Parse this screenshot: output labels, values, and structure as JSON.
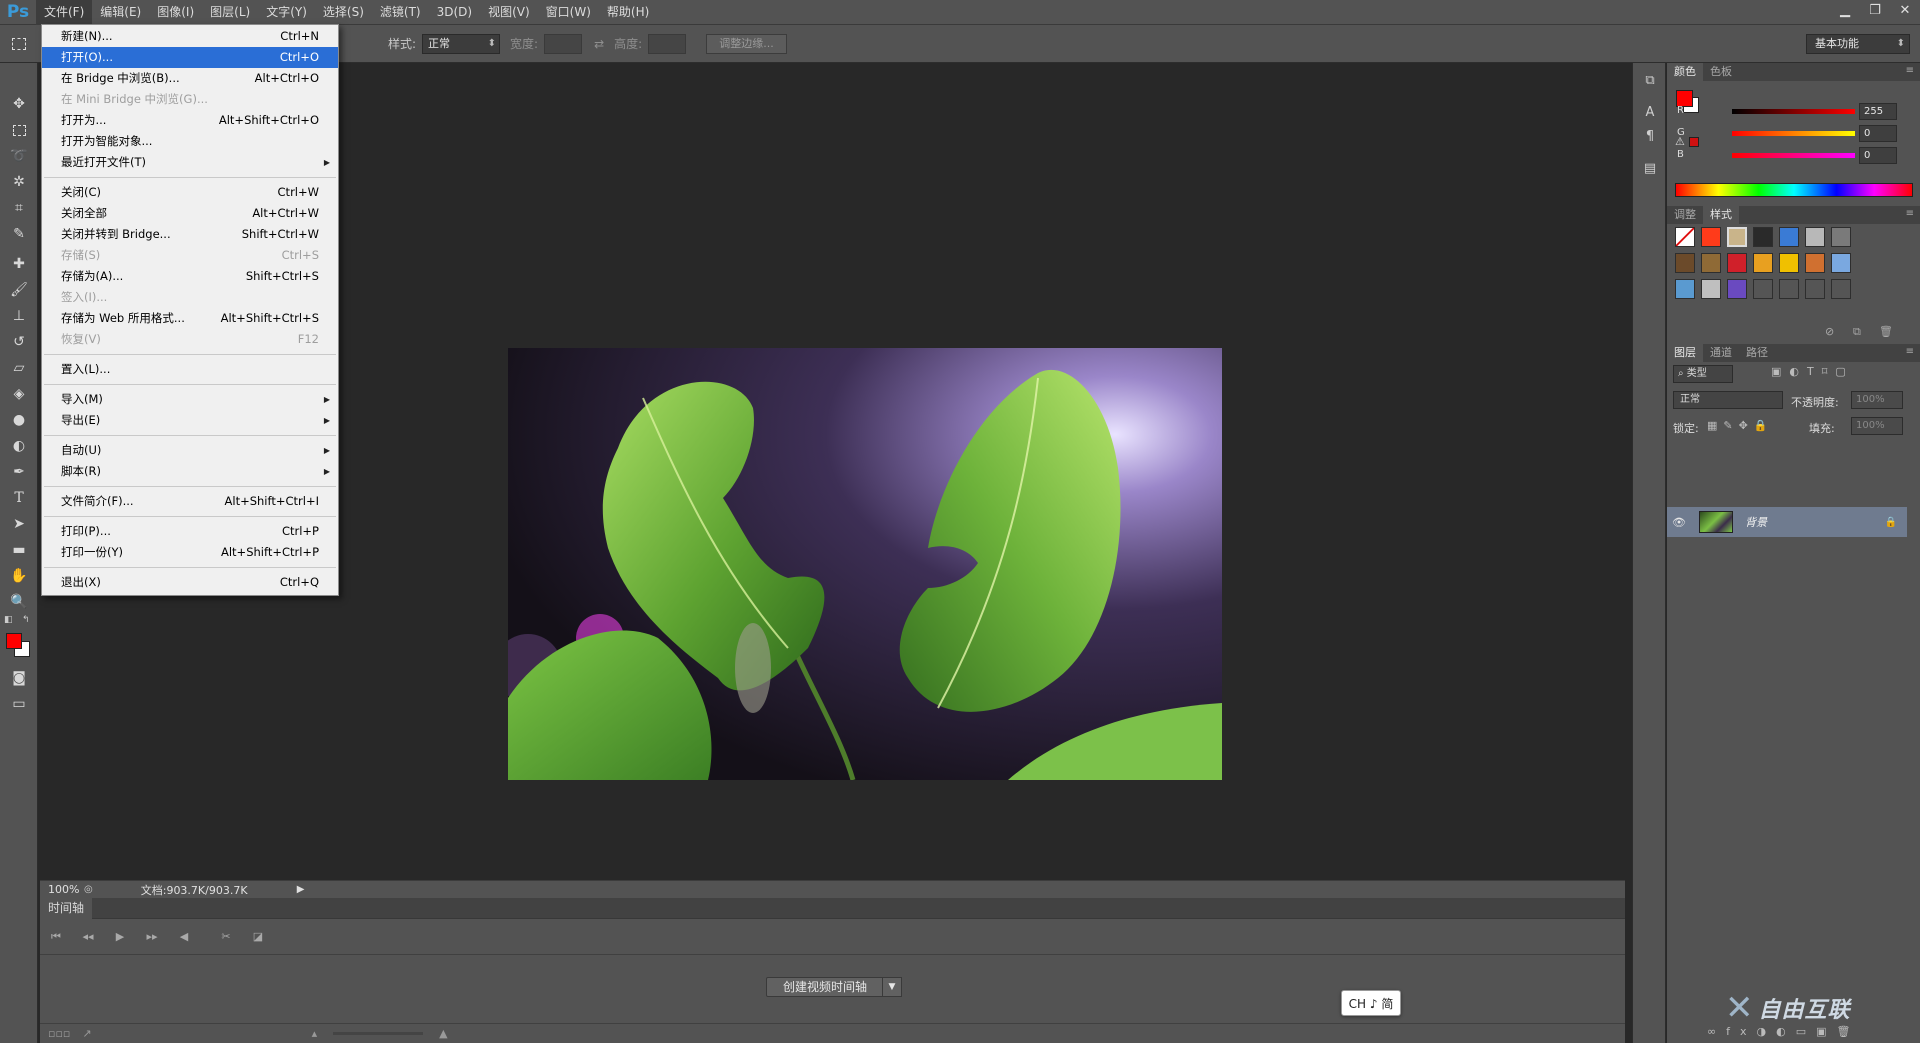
{
  "app": {
    "logo": "Ps",
    "menu": [
      "文件(F)",
      "编辑(E)",
      "图像(I)",
      "图层(L)",
      "文字(Y)",
      "选择(S)",
      "滤镜(T)",
      "3D(D)",
      "视图(V)",
      "窗口(W)",
      "帮助(H)"
    ],
    "active_menu_index": 0
  },
  "options_bar": {
    "style_label": "样式:",
    "style_value": "正常",
    "width_label": "宽度:",
    "height_label": "高度:",
    "refine_edge": "调整边缘...",
    "workspace": "基本功能"
  },
  "file_menu": {
    "items": [
      {
        "label": "新建(N)...",
        "shortcut": "Ctrl+N",
        "state": "normal"
      },
      {
        "label": "打开(O)...",
        "shortcut": "Ctrl+O",
        "state": "highlight"
      },
      {
        "label": "在 Bridge 中浏览(B)...",
        "shortcut": "Alt+Ctrl+O",
        "state": "normal"
      },
      {
        "label": "在 Mini Bridge 中浏览(G)...",
        "shortcut": "",
        "state": "disabled"
      },
      {
        "label": "打开为...",
        "shortcut": "Alt+Shift+Ctrl+O",
        "state": "normal"
      },
      {
        "label": "打开为智能对象...",
        "shortcut": "",
        "state": "normal"
      },
      {
        "label": "最近打开文件(T)",
        "shortcut": "",
        "state": "normal",
        "submenu": true
      },
      {
        "separator": true
      },
      {
        "label": "关闭(C)",
        "shortcut": "Ctrl+W",
        "state": "normal"
      },
      {
        "label": "关闭全部",
        "shortcut": "Alt+Ctrl+W",
        "state": "normal"
      },
      {
        "label": "关闭并转到 Bridge...",
        "shortcut": "Shift+Ctrl+W",
        "state": "normal"
      },
      {
        "label": "存储(S)",
        "shortcut": "Ctrl+S",
        "state": "disabled"
      },
      {
        "label": "存储为(A)...",
        "shortcut": "Shift+Ctrl+S",
        "state": "normal"
      },
      {
        "label": "签入(I)...",
        "shortcut": "",
        "state": "disabled"
      },
      {
        "label": "存储为 Web 所用格式...",
        "shortcut": "Alt+Shift+Ctrl+S",
        "state": "normal"
      },
      {
        "label": "恢复(V)",
        "shortcut": "F12",
        "state": "disabled"
      },
      {
        "separator": true
      },
      {
        "label": "置入(L)...",
        "shortcut": "",
        "state": "normal"
      },
      {
        "separator": true
      },
      {
        "label": "导入(M)",
        "shortcut": "",
        "state": "normal",
        "submenu": true
      },
      {
        "label": "导出(E)",
        "shortcut": "",
        "state": "normal",
        "submenu": true
      },
      {
        "separator": true
      },
      {
        "label": "自动(U)",
        "shortcut": "",
        "state": "normal",
        "submenu": true
      },
      {
        "label": "脚本(R)",
        "shortcut": "",
        "state": "normal",
        "submenu": true
      },
      {
        "separator": true
      },
      {
        "label": "文件简介(F)...",
        "shortcut": "Alt+Shift+Ctrl+I",
        "state": "normal"
      },
      {
        "separator": true
      },
      {
        "label": "打印(P)...",
        "shortcut": "Ctrl+P",
        "state": "normal"
      },
      {
        "label": "打印一份(Y)",
        "shortcut": "Alt+Shift+Ctrl+P",
        "state": "normal"
      },
      {
        "separator": true
      },
      {
        "label": "退出(X)",
        "shortcut": "Ctrl+Q",
        "state": "normal"
      }
    ]
  },
  "status_bar": {
    "zoom": "100%",
    "doc_info": "文档:903.7K/903.7K"
  },
  "timeline": {
    "tab": "时间轴",
    "create_button": "创建视频时间轴"
  },
  "color_panel": {
    "tabs": [
      "颜色",
      "色板"
    ],
    "r_label": "R",
    "r_value": "255",
    "g_label": "G",
    "g_value": "0",
    "b_label": "B",
    "b_value": "0",
    "foreground": "#ff0000",
    "background": "#ffffff"
  },
  "styles_panel": {
    "tabs": [
      "调整",
      "样式"
    ]
  },
  "layers_panel": {
    "tabs": [
      "图层",
      "通道",
      "路径"
    ],
    "filter_label": "类型",
    "blend_mode": "正常",
    "opacity_label": "不透明度:",
    "opacity_value": "100%",
    "lock_label": "锁定:",
    "fill_label": "填充:",
    "fill_value": "100%",
    "layer_name": "背景"
  },
  "ime": "CH ♪ 简",
  "watermark": "自由互联"
}
